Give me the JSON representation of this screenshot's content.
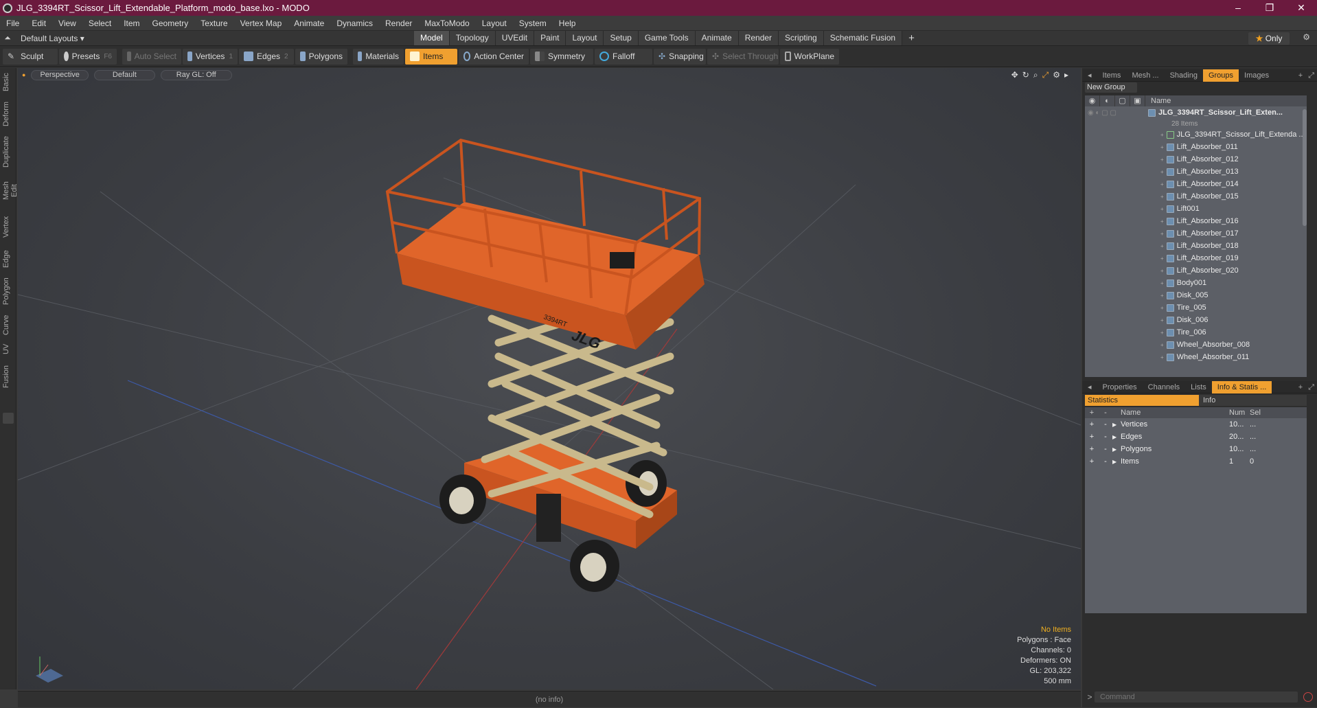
{
  "window": {
    "title": "JLG_3394RT_Scissor_Lift_Extendable_Platform_modo_base.lxo - MODO",
    "controls": [
      "–",
      "❐",
      "✕"
    ]
  },
  "menu": [
    "File",
    "Edit",
    "View",
    "Select",
    "Item",
    "Geometry",
    "Texture",
    "Vertex Map",
    "Animate",
    "Dynamics",
    "Render",
    "MaxToModo",
    "Layout",
    "System",
    "Help"
  ],
  "layoutbar": {
    "layout_selector": "Default Layouts ▾",
    "tabs": [
      "Model",
      "Topology",
      "UVEdit",
      "Paint",
      "Layout",
      "Setup",
      "Game Tools",
      "Animate",
      "Render",
      "Scripting",
      "Schematic Fusion"
    ],
    "active_tab": "Model",
    "only_label": "Only"
  },
  "toolbar": {
    "sculpt": "Sculpt",
    "presets": "Presets",
    "presets_key": "F6",
    "auto_select": "Auto Select",
    "vertices": "Vertices",
    "vertices_count": "1",
    "edges": "Edges",
    "edges_count": "2",
    "polygons": "Polygons",
    "materials": "Materials",
    "items": "Items",
    "action_center": "Action Center",
    "symmetry": "Symmetry",
    "falloff": "Falloff",
    "snapping": "Snapping",
    "select_through": "Select Through",
    "workplane": "WorkPlane"
  },
  "left_tabs": [
    "Basic",
    "Deform",
    "Duplicate",
    "Mesh Edit",
    "Vertex",
    "Edge",
    "Polygon",
    "Curve",
    "UV",
    "Fusion"
  ],
  "viewport": {
    "view": "Perspective",
    "shading": "Default",
    "raygl": "Ray GL: Off",
    "hud": {
      "selection": "No Items",
      "polygons": "Polygons : Face",
      "channels": "Channels: 0",
      "deformers": "Deformers: ON",
      "gl": "GL: 203,322",
      "scale": "500 mm"
    },
    "brand_text": "JLG",
    "model_text": "3394RT"
  },
  "status": "(no info)",
  "groups_panel": {
    "tabs": [
      "Items",
      "Mesh ...",
      "Shading",
      "Groups",
      "Images"
    ],
    "active_tab": "Groups",
    "new_group": "New Group",
    "name_header": "Name",
    "root": "JLG_3394RT_Scissor_Lift_Exten...",
    "root_count": "28 Items",
    "items": [
      "JLG_3394RT_Scissor_Lift_Extenda ...",
      "Lift_Absorber_011",
      "Lift_Absorber_012",
      "Lift_Absorber_013",
      "Lift_Absorber_014",
      "Lift_Absorber_015",
      "Lift001",
      "Lift_Absorber_016",
      "Lift_Absorber_017",
      "Lift_Absorber_018",
      "Lift_Absorber_019",
      "Lift_Absorber_020",
      "Body001",
      "Disk_005",
      "Tire_005",
      "Disk_006",
      "Tire_006",
      "Wheel_Absorber_008",
      "Wheel_Absorber_011"
    ]
  },
  "stats_panel": {
    "tabs": [
      "Properties",
      "Channels",
      "Lists",
      "Info & Statis ..."
    ],
    "active_tab": "Info & Statis ...",
    "statistics": "Statistics",
    "info": "Info",
    "headers": {
      "name": "Name",
      "num": "Num",
      "sel": "Sel"
    },
    "rows": [
      {
        "name": "Vertices",
        "num": "10...",
        "sel": "..."
      },
      {
        "name": "Edges",
        "num": "20...",
        "sel": "..."
      },
      {
        "name": "Polygons",
        "num": "10...",
        "sel": "..."
      },
      {
        "name": "Items",
        "num": "1",
        "sel": "0"
      }
    ]
  },
  "command": {
    "placeholder": "Command"
  },
  "colors": {
    "accent": "#f0a030",
    "title_bar": "#6b1a3e",
    "lift_orange": "#e0652a",
    "scissor_beige": "#c9b98c"
  }
}
